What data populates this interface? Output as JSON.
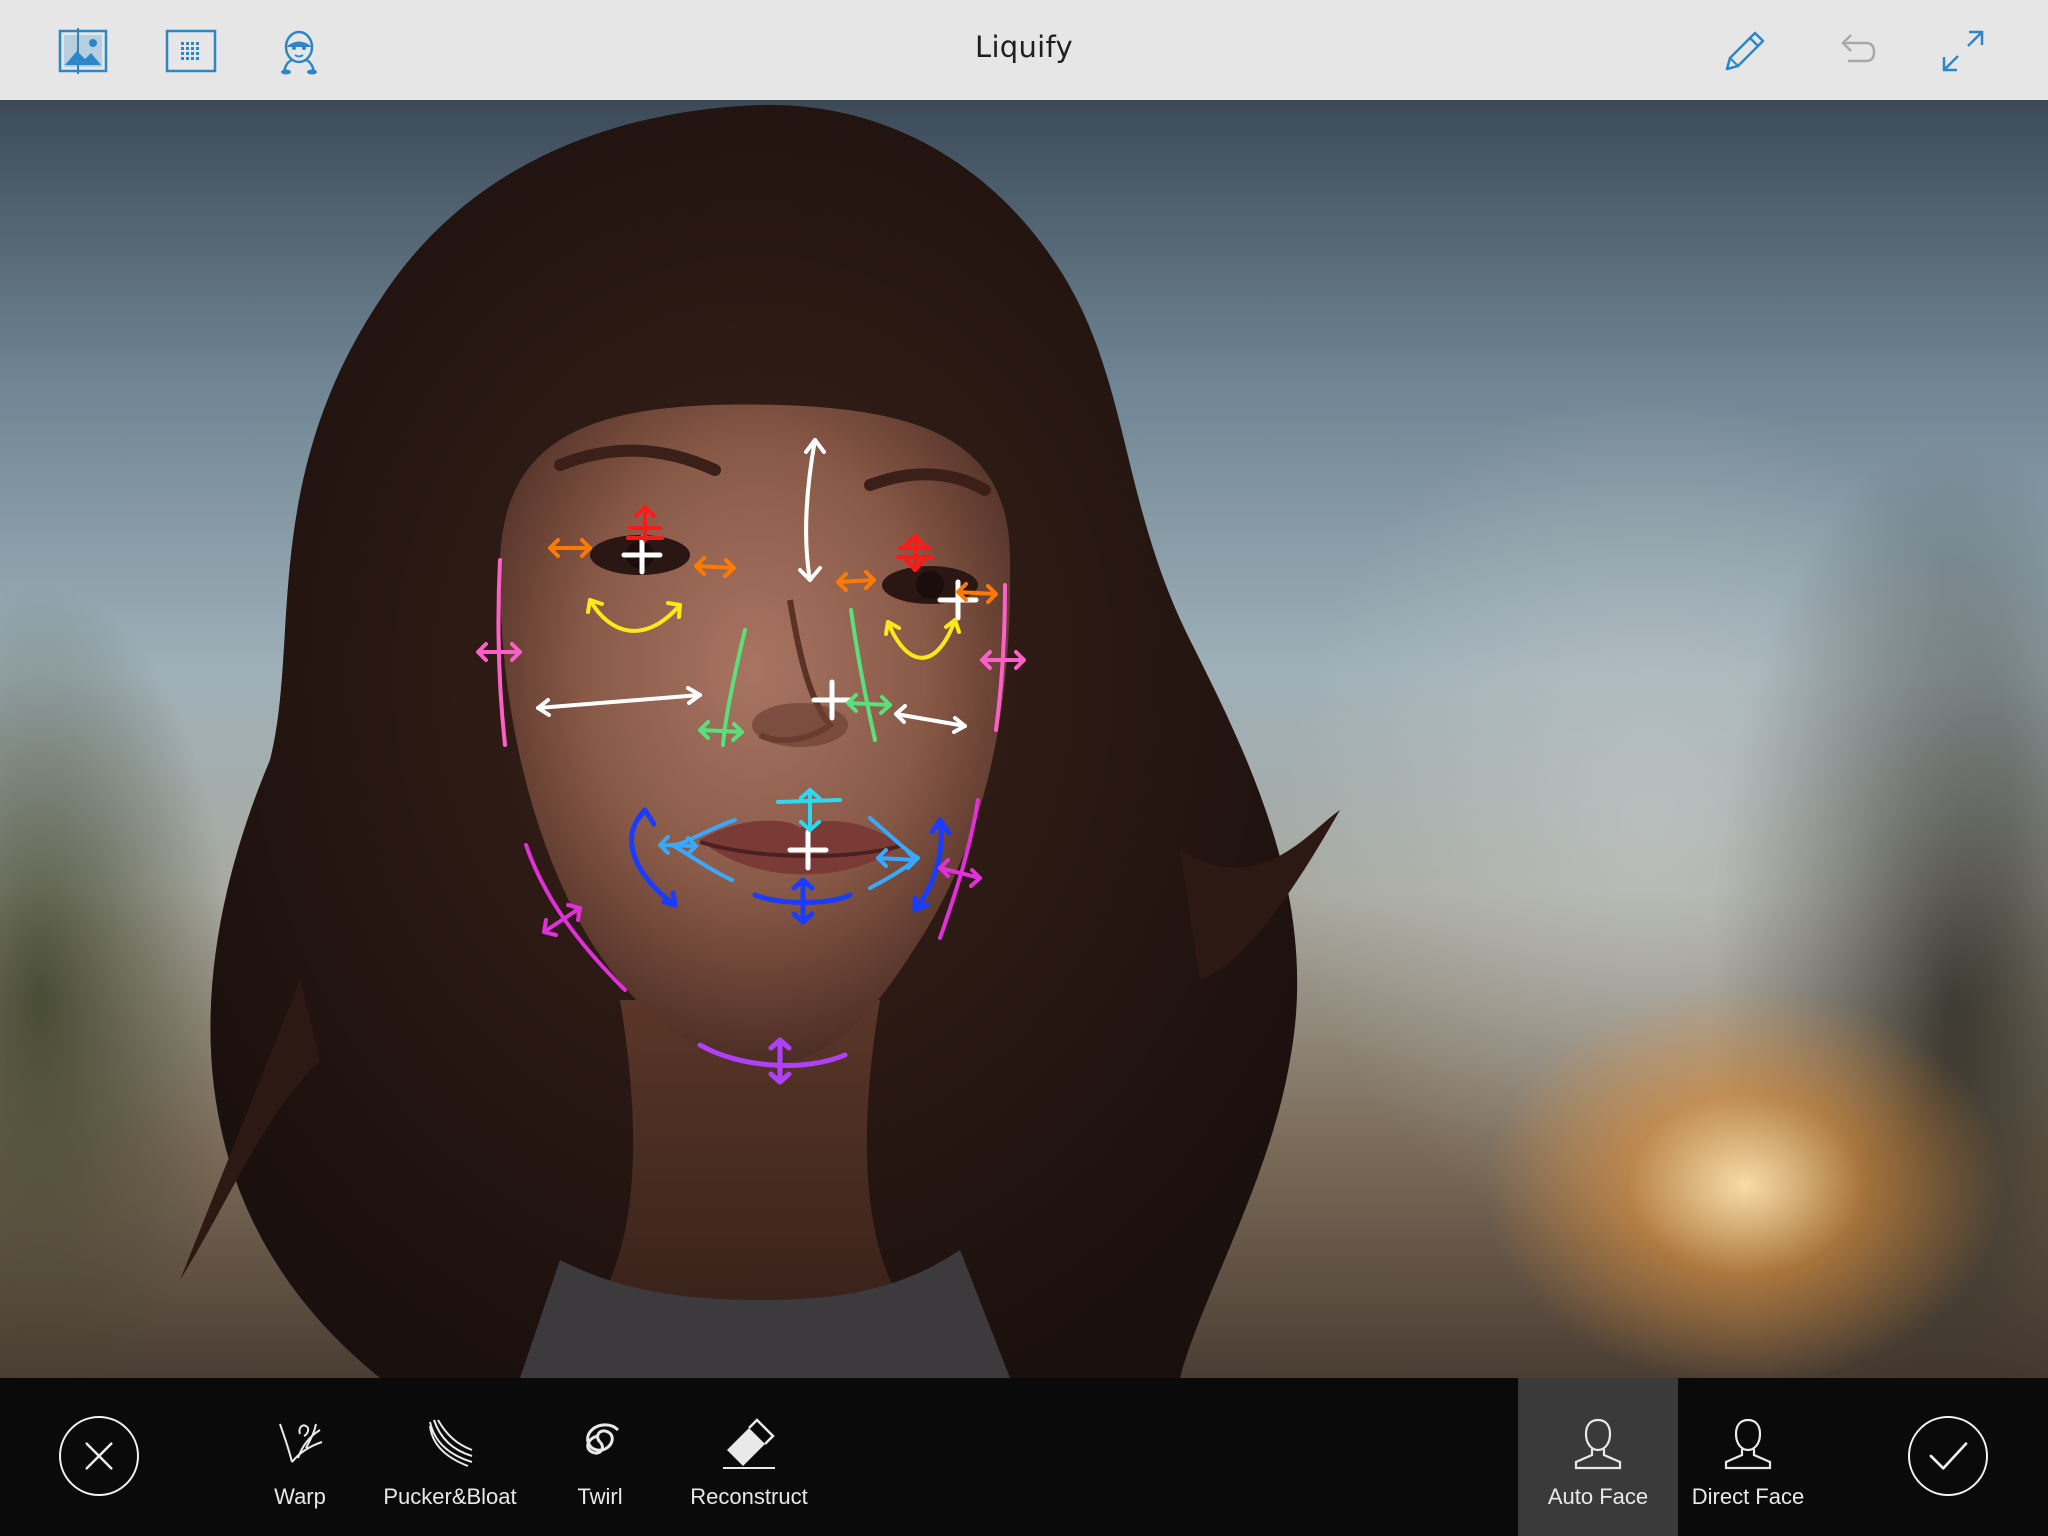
{
  "header": {
    "title": "Liquify",
    "left_icons": [
      "image-adjust-icon",
      "grid-icon",
      "face-mask-icon"
    ],
    "right_icons": [
      "pencil-icon",
      "undo-icon",
      "expand-icon"
    ]
  },
  "toolbar": {
    "cancel_icon": "close-icon",
    "tools": [
      {
        "label": "Warp",
        "icon": "warp-icon"
      },
      {
        "label": "Pucker&Bloat",
        "icon": "pucker-bloat-icon"
      },
      {
        "label": "Twirl",
        "icon": "twirl-icon"
      },
      {
        "label": "Reconstruct",
        "icon": "eraser-icon"
      }
    ],
    "face_modes": [
      {
        "label": "Auto Face",
        "icon": "person-icon",
        "selected": true
      },
      {
        "label": "Direct Face",
        "icon": "person-icon",
        "selected": false
      }
    ],
    "confirm_icon": "checkmark-icon"
  },
  "colors": {
    "toolbar_bg": "#e6e6e6",
    "accent": "#2b87c8",
    "bottom_bg": "#0a0a0a",
    "active_tool_bg": "#3a3a3a",
    "handle_white": "#ffffff",
    "handle_red": "#ff1a1a",
    "handle_orange": "#ff7a00",
    "handle_yellow": "#ffe81a",
    "handle_pink": "#ff5fc8",
    "handle_green": "#59e07a",
    "handle_cyan": "#2fd8f0",
    "handle_lightblue": "#3aa8ff",
    "handle_blue": "#1a3cff",
    "handle_magenta": "#e030d8",
    "handle_purple": "#b040ff"
  }
}
